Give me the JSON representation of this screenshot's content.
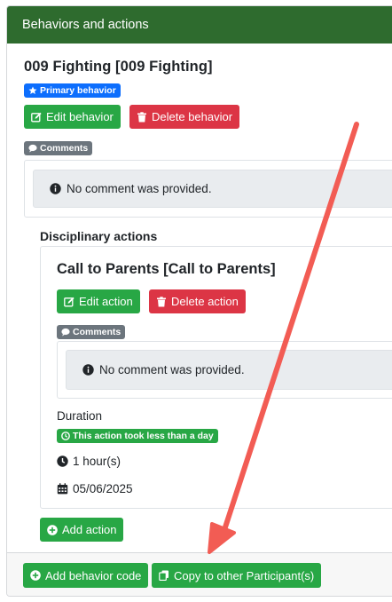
{
  "header": {
    "title": "Behaviors and actions"
  },
  "behavior": {
    "title": "009 Fighting [009 Fighting]",
    "badge": "Primary behavior",
    "edit_label": "Edit behavior",
    "delete_label": "Delete behavior",
    "comments_badge": "Comments",
    "comment_text": "No comment was provided."
  },
  "disciplinary": {
    "heading": "Disciplinary actions",
    "action": {
      "title": "Call to Parents [Call to Parents]",
      "edit_label": "Edit action",
      "delete_label": "Delete action",
      "comments_badge": "Comments",
      "comment_text": "No comment was provided.",
      "duration_label": "Duration",
      "duration_badge": "This action took less than a day",
      "hours": "1 hour(s)",
      "date": "05/06/2025"
    },
    "add_action_label": "Add action"
  },
  "footer": {
    "add_behavior_code_label": "Add behavior code",
    "copy_label": "Copy to other Participant(s)"
  },
  "colors": {
    "header_bg": "#2e6b2e",
    "success": "#28a745",
    "danger": "#dc3545",
    "primary": "#0d6efd",
    "annotation_arrow": "#f25c54"
  }
}
